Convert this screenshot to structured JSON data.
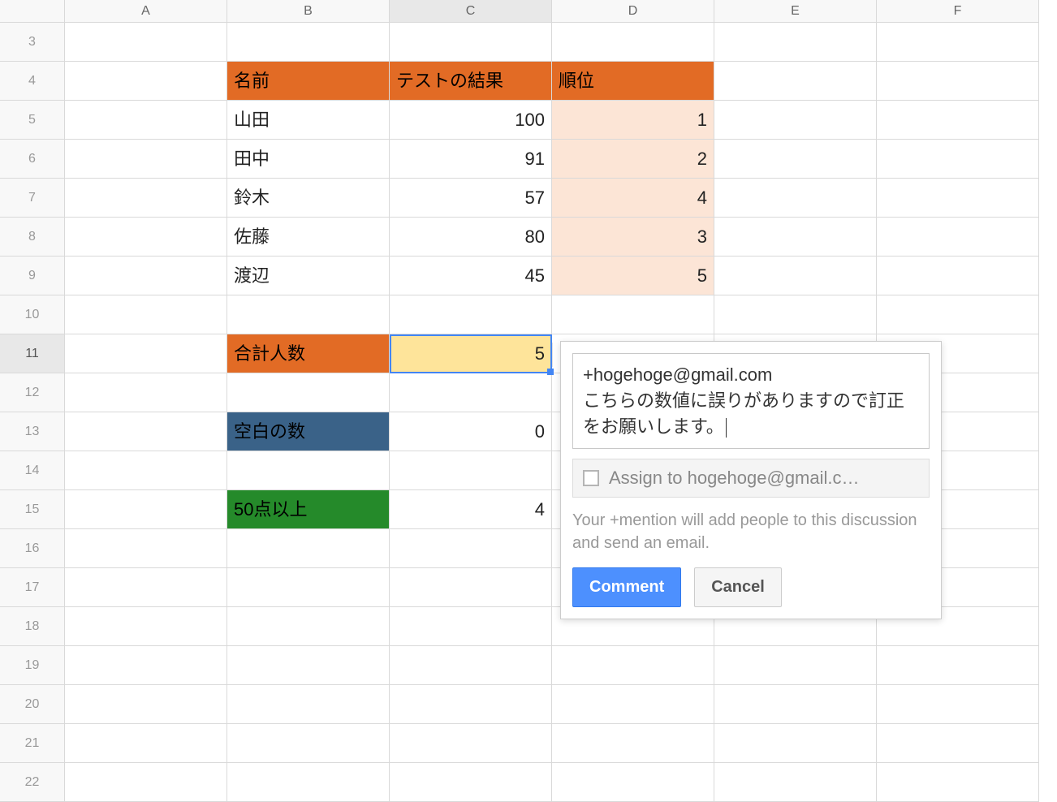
{
  "columns": [
    "A",
    "B",
    "C",
    "D",
    "E",
    "F"
  ],
  "visible_rows": [
    3,
    4,
    5,
    6,
    7,
    8,
    9,
    10,
    11,
    12,
    13,
    14,
    15,
    16,
    17,
    18,
    19,
    20,
    21,
    22
  ],
  "selected_col": "C",
  "selected_row": 11,
  "table_header": {
    "name": "名前",
    "test_result": "テストの結果",
    "rank": "順位"
  },
  "data_rows": [
    {
      "name": "山田",
      "score": "100",
      "rank": "1"
    },
    {
      "name": "田中",
      "score": "91",
      "rank": "2"
    },
    {
      "name": "鈴木",
      "score": "57",
      "rank": "4"
    },
    {
      "name": "佐藤",
      "score": "80",
      "rank": "3"
    },
    {
      "name": "渡辺",
      "score": "45",
      "rank": "5"
    }
  ],
  "summary": {
    "count_label": "合計人数",
    "count_value": "5",
    "blank_label": "空白の数",
    "blank_value": "0",
    "over50_label": "50点以上",
    "over50_value": "4"
  },
  "comment": {
    "text_line1": "+hogehoge@gmail.com",
    "text_line2": "こちらの数値に誤りがありますので訂正をお願いします。",
    "assign_label": "Assign to hogehoge@gmail.c…",
    "mention_note": "Your +mention will add people to this discussion and send an email.",
    "comment_button": "Comment",
    "cancel_button": "Cancel"
  }
}
